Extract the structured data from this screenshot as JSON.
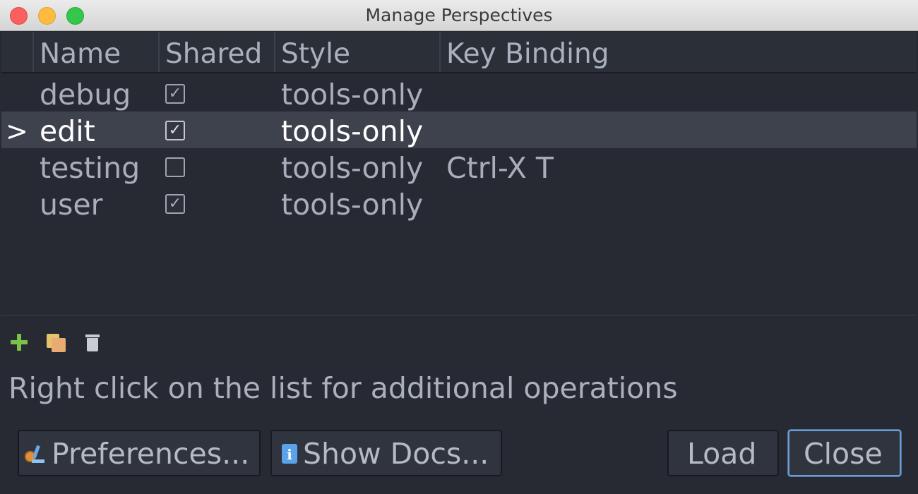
{
  "window": {
    "title": "Manage Perspectives"
  },
  "table": {
    "columns": [
      "Name",
      "Shared",
      "Style",
      "Key Binding"
    ],
    "rows": [
      {
        "marker": "",
        "name": "debug",
        "shared": true,
        "style": "tools-only",
        "key_binding": ""
      },
      {
        "marker": ">",
        "name": "edit",
        "shared": true,
        "style": "tools-only",
        "key_binding": "",
        "selected": true
      },
      {
        "marker": "",
        "name": "testing",
        "shared": false,
        "style": "tools-only",
        "key_binding": "Ctrl-X T"
      },
      {
        "marker": "",
        "name": "user",
        "shared": true,
        "style": "tools-only",
        "key_binding": ""
      }
    ]
  },
  "toolbar": {
    "icons": [
      "plus-icon",
      "copy-icon",
      "trash-icon"
    ]
  },
  "hint": "Right click on the list for additional operations",
  "buttons": {
    "preferences": "Preferences...",
    "show_docs": "Show Docs...",
    "load": "Load",
    "close": "Close"
  },
  "colors": {
    "background": "#272a33",
    "selected_row": "#3e424d",
    "close_focus": "#6f9bcf"
  }
}
